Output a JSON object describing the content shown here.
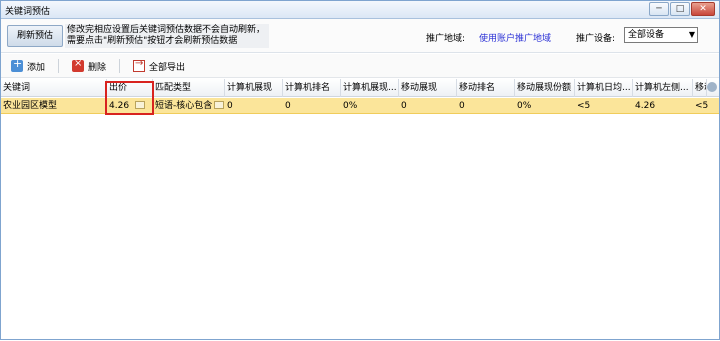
{
  "window": {
    "title": "关键词预估",
    "buttons": [
      "─",
      "□",
      "✕"
    ]
  },
  "topbar": {
    "refresh_button": "刷新预估",
    "notice_line1": "修改完相应设置后关键词预估数据不会自动刷新，",
    "notice_line2": "需要点击\"刷新预估\"按钮才会刷新预估数据",
    "region_label": "推广地域:",
    "region_link": "使用账户推广地域",
    "device_label": "推广设备:",
    "device_value": "全部设备"
  },
  "toolbar": {
    "add": "添加",
    "delete": "删除",
    "export_all": "全部导出"
  },
  "table": {
    "headers": [
      "关键词",
      "出价",
      "匹配类型",
      "计算机展现",
      "计算机排名",
      "计算机展现...",
      "移动展现",
      "移动排名",
      "移动展现份额",
      "计算机日均...",
      "计算机左侧...",
      "移动"
    ],
    "rows": [
      {
        "keyword": "农业园区模型",
        "bid": "4.26",
        "match_type": "短语-核心包含",
        "pc_impressions": "0",
        "pc_rank": "0",
        "pc_share": "0%",
        "mobile_impressions": "0",
        "mobile_rank": "0",
        "mobile_share": "0%",
        "pc_daily": "<5",
        "pc_left": "4.26",
        "mobile_extra": "<5"
      }
    ]
  },
  "icons": {
    "add": "add-icon",
    "delete": "delete-icon",
    "export": "export-icon",
    "edit": "edit-icon",
    "settings": "settings-gear-icon"
  },
  "colors": {
    "selected_row": "#fbe59a",
    "highlight_box": "#d8231f",
    "link": "#2b31d6"
  }
}
